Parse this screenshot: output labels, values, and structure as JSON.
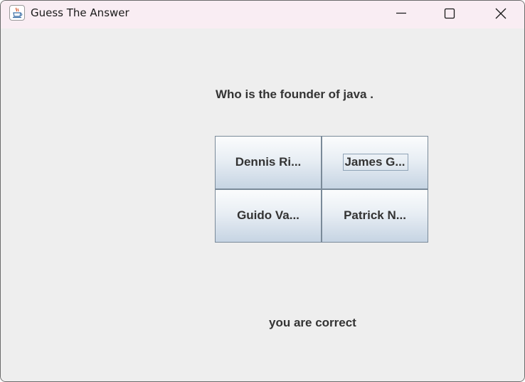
{
  "window": {
    "title": "Guess The Answer",
    "icon": "java-cup-icon",
    "controls": {
      "minimize": "minimize-icon",
      "maximize": "maximize-icon",
      "close": "close-icon"
    }
  },
  "quiz": {
    "question": "Who is the founder of java .",
    "options": [
      {
        "label": "Dennis Ri..."
      },
      {
        "label": "James G..."
      },
      {
        "label": "Guido Va..."
      },
      {
        "label": "Patrick N..."
      }
    ],
    "focused_option": "James G...",
    "result": "you are correct"
  },
  "colors": {
    "titlebar": "#f9edf3",
    "background": "#eeeeee",
    "text": "#333333",
    "button_border": "#7a8a99"
  }
}
